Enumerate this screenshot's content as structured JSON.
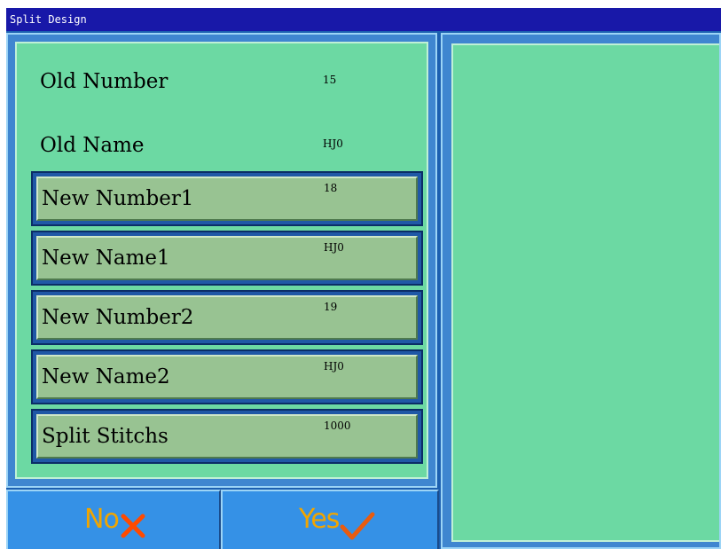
{
  "window": {
    "title": "Split Design"
  },
  "info": {
    "old_number": {
      "label": "Old Number",
      "value": "15"
    },
    "old_name": {
      "label": "Old Name",
      "value": "HJ0"
    }
  },
  "fields": [
    {
      "label": "New Number1",
      "value": "18"
    },
    {
      "label": "New Name1",
      "value": "HJ0"
    },
    {
      "label": "New Number2",
      "value": "19"
    },
    {
      "label": "New Name2",
      "value": "HJ0"
    },
    {
      "label": "Split Stitchs",
      "value": "1000"
    }
  ],
  "buttons": {
    "no": {
      "label": "No",
      "icon": "x-mark-icon"
    },
    "yes": {
      "label": "Yes",
      "icon": "check-mark-icon"
    }
  },
  "colors": {
    "title_bar": "#1818a8",
    "panel_green": "#6cd9a3",
    "field_green": "#98c392",
    "button_blue": "#3591e6",
    "button_text": "#f1a500",
    "x_mark": "#ff4a00",
    "check_mark": "#e85c10"
  }
}
